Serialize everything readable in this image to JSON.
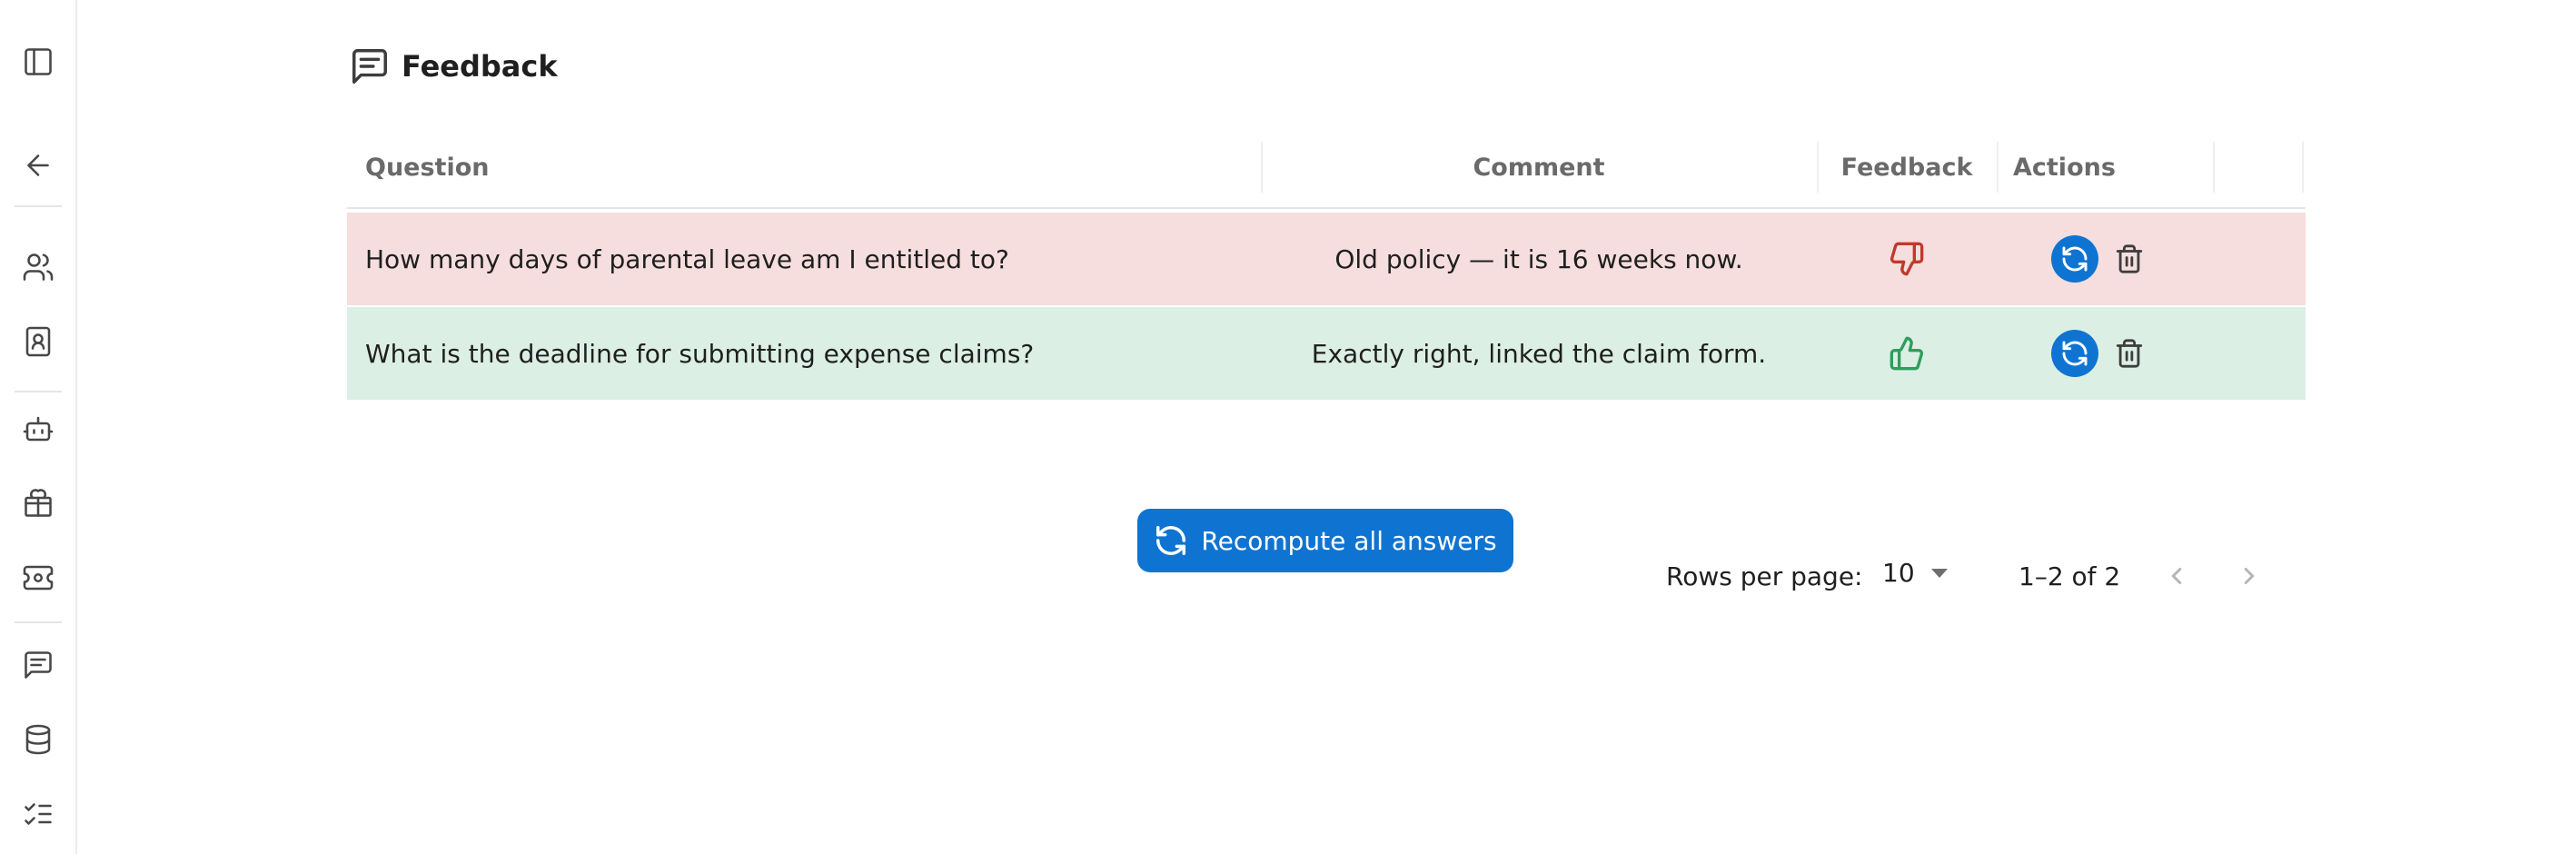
{
  "header": {
    "title": "Feedback",
    "icon": "message-square-text-icon"
  },
  "sidebar": {
    "items": [
      {
        "name": "toggle-sidebar",
        "icon": "panel-left-icon"
      },
      {
        "name": "back",
        "icon": "arrow-left-icon"
      },
      {
        "name": "users",
        "icon": "users-icon"
      },
      {
        "name": "contacts",
        "icon": "contact-book-icon"
      },
      {
        "name": "bot",
        "icon": "bot-icon"
      },
      {
        "name": "package",
        "icon": "package-icon"
      },
      {
        "name": "settings-ticket",
        "icon": "ticket-gear-icon"
      },
      {
        "name": "feedback",
        "icon": "message-square-text-icon"
      },
      {
        "name": "database",
        "icon": "database-icon"
      },
      {
        "name": "checklist",
        "icon": "list-checks-icon"
      }
    ]
  },
  "table": {
    "columns": {
      "question": "Question",
      "comment": "Comment",
      "feedback": "Feedback",
      "actions": "Actions"
    },
    "rows": [
      {
        "question": "How many days of parental leave am I entitled to?",
        "comment": "Old policy — it is 16 weeks now.",
        "feedback": "negative",
        "row_color": "#f5dedd"
      },
      {
        "question": "What is the deadline for submitting expense claims?",
        "comment": "Exactly right, linked the claim form.",
        "feedback": "positive",
        "row_color": "#dcefe5"
      }
    ]
  },
  "pagination": {
    "rows_per_page_label": "Rows per page:",
    "rows_per_page_value": "10",
    "range": "1–2 of 2"
  },
  "recompute_button": {
    "label": "Recompute all answers"
  },
  "colors": {
    "primary": "#0f74d1",
    "negative": "#c0392b",
    "positive": "#2e9e5b"
  }
}
